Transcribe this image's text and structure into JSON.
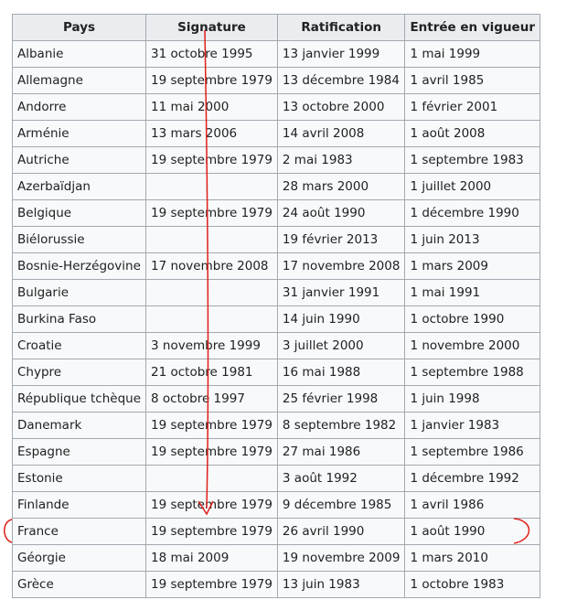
{
  "table": {
    "headers": [
      "Pays",
      "Signature",
      "Ratification",
      "Entrée en vigueur"
    ],
    "rows": [
      {
        "pays": "Albanie",
        "signature": "31 octobre 1995",
        "ratification": "13 janvier 1999",
        "entree": "1 mai 1999"
      },
      {
        "pays": "Allemagne",
        "signature": "19 septembre 1979",
        "ratification": "13 décembre 1984",
        "entree": "1 avril 1985"
      },
      {
        "pays": "Andorre",
        "signature": "11 mai 2000",
        "ratification": "13 octobre 2000",
        "entree": "1 février 2001"
      },
      {
        "pays": "Arménie",
        "signature": "13 mars 2006",
        "ratification": "14 avril 2008",
        "entree": "1 août 2008"
      },
      {
        "pays": "Autriche",
        "signature": "19 septembre 1979",
        "ratification": "2 mai 1983",
        "entree": "1 septembre 1983"
      },
      {
        "pays": "Azerbaïdjan",
        "signature": "",
        "ratification": "28 mars 2000",
        "entree": "1 juillet 2000"
      },
      {
        "pays": "Belgique",
        "signature": "19 septembre 1979",
        "ratification": "24 août 1990",
        "entree": "1 décembre 1990"
      },
      {
        "pays": "Biélorussie",
        "signature": "",
        "ratification": "19 février 2013",
        "entree": "1 juin 2013"
      },
      {
        "pays": "Bosnie-Herzégovine",
        "signature": "17 novembre 2008",
        "ratification": "17 novembre 2008",
        "entree": "1 mars 2009"
      },
      {
        "pays": "Bulgarie",
        "signature": "",
        "ratification": "31 janvier 1991",
        "entree": "1 mai 1991"
      },
      {
        "pays": "Burkina Faso",
        "signature": "",
        "ratification": "14 juin 1990",
        "entree": "1 octobre 1990"
      },
      {
        "pays": "Croatie",
        "signature": "3 novembre 1999",
        "ratification": "3 juillet 2000",
        "entree": "1 novembre 2000"
      },
      {
        "pays": "Chypre",
        "signature": "21 octobre 1981",
        "ratification": "16 mai 1988",
        "entree": "1 septembre 1988"
      },
      {
        "pays": "République tchèque",
        "signature": "8 octobre 1997",
        "ratification": "25 février 1998",
        "entree": "1 juin 1998"
      },
      {
        "pays": "Danemark",
        "signature": "19 septembre 1979",
        "ratification": "8 septembre 1982",
        "entree": "1 janvier 1983"
      },
      {
        "pays": "Espagne",
        "signature": "19 septembre 1979",
        "ratification": "27 mai 1986",
        "entree": "1 septembre 1986"
      },
      {
        "pays": "Estonie",
        "signature": "",
        "ratification": "3 août 1992",
        "entree": "1 décembre 1992"
      },
      {
        "pays": "Finlande",
        "signature": "19 septembre 1979",
        "ratification": "9 décembre 1985",
        "entree": "1 avril 1986"
      },
      {
        "pays": "France",
        "signature": "19 septembre 1979",
        "ratification": "26 avril 1990",
        "entree": "1 août 1990"
      },
      {
        "pays": "Géorgie",
        "signature": "18 mai 2009",
        "ratification": "19 novembre 2009",
        "entree": "1 mars 2010"
      },
      {
        "pays": "Grèce",
        "signature": "19 septembre 1979",
        "ratification": "13 juin 1983",
        "entree": "1 octobre 1983"
      }
    ]
  },
  "annotation": {
    "color": "#e0201a",
    "arrow": "red-down-arrow-icon",
    "highlight": "red-bracket-highlight-icon",
    "highlighted_row": "France"
  }
}
